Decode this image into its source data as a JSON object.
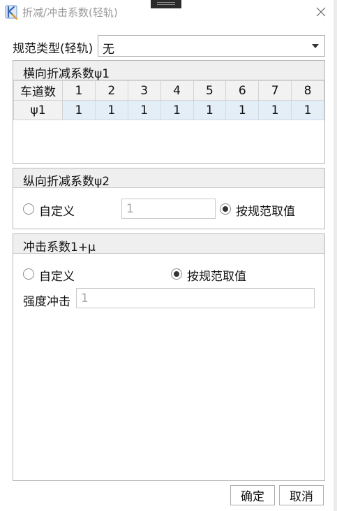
{
  "window": {
    "title": "折减/冲击系数(轻轨)",
    "close_icon": "close-icon",
    "app_icon": "app-logo-icon"
  },
  "spec": {
    "label": "规范类型(轻轨)",
    "value": "无"
  },
  "lateral": {
    "title": "横向折减系数ψ1",
    "header": [
      "车道数",
      "1",
      "2",
      "3",
      "4",
      "5",
      "6",
      "7",
      "8"
    ],
    "row": [
      "ψ1",
      "1",
      "1",
      "1",
      "1",
      "1",
      "1",
      "1",
      "1"
    ]
  },
  "longitudinal": {
    "title": "纵向折减系数ψ2",
    "custom_label": "自定义",
    "custom_selected": false,
    "value": "1",
    "spec_label": "按规范取值",
    "spec_selected": true
  },
  "impact": {
    "title": "冲击系数1+μ",
    "custom_label": "自定义",
    "custom_selected": false,
    "spec_label": "按规范取值",
    "spec_selected": true,
    "strength_label": "强度冲击",
    "strength_value": "1"
  },
  "buttons": {
    "ok": "确定",
    "cancel": "取消"
  },
  "colors": {
    "selected_row": "#e4eef7",
    "header_bg": "#efefef"
  }
}
